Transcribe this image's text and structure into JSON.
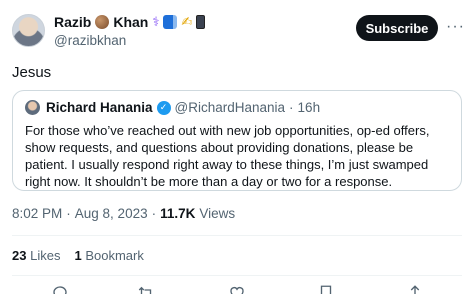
{
  "author": {
    "name": "Razib",
    "name_suffix": "Khan",
    "handle": "@razibkhan",
    "emojis": [
      "basketball-emoji",
      "dna-emoji",
      "book-emoji",
      "pen-emoji",
      "phone-emoji"
    ]
  },
  "actions": {
    "subscribe_label": "Subscribe",
    "more_label": "···"
  },
  "tweet": {
    "text": "Jesus"
  },
  "quote": {
    "name": "Richard Hanania",
    "handle": "@RichardHanania",
    "separator": "·",
    "time": "16h",
    "text": "For those who’ve reached out with new job opportunities, op-ed offers, show requests, and questions about providing donations, please be patient. I usually respond right away to these things, I’m just swamped right now. It shouldn’t be more than a day or two for a response."
  },
  "meta": {
    "time": "8:02 PM",
    "separator1": "·",
    "date": "Aug 8, 2023",
    "separator2": "·",
    "views_count": "11.7K",
    "views_label": "Views"
  },
  "stats": {
    "likes_count": "23",
    "likes_label": "Likes",
    "bookmarks_count": "1",
    "bookmarks_label": "Bookmark"
  },
  "colors": {
    "text": "#0f1419",
    "secondary": "#536471",
    "verified": "#1d9bf0",
    "border": "#cfd9de"
  },
  "icons": [
    "reply-icon",
    "retweet-icon",
    "like-icon",
    "bookmark-icon",
    "share-icon"
  ]
}
